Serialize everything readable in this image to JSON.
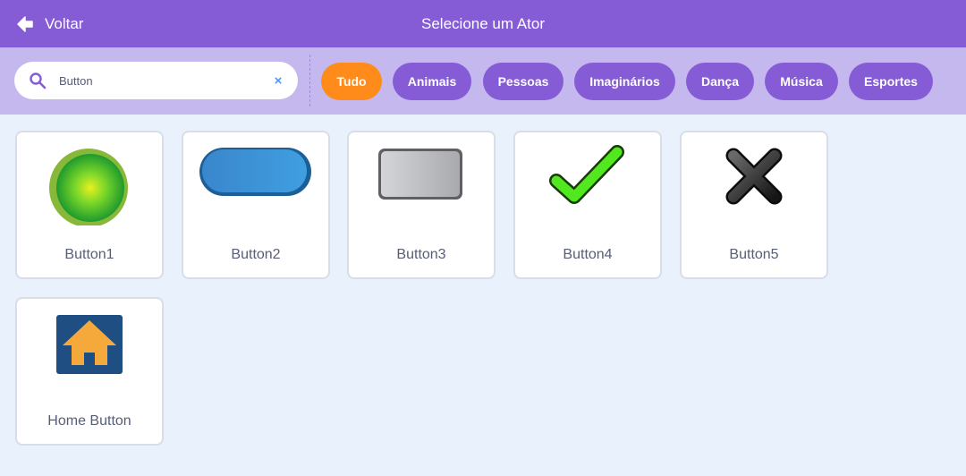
{
  "header": {
    "back_label": "Voltar",
    "title": "Selecione um Ator"
  },
  "search": {
    "value": "Button",
    "clear_glyph": "×"
  },
  "tags": [
    {
      "label": "Tudo",
      "active": true
    },
    {
      "label": "Animais",
      "active": false
    },
    {
      "label": "Pessoas",
      "active": false
    },
    {
      "label": "Imaginários",
      "active": false
    },
    {
      "label": "Dança",
      "active": false
    },
    {
      "label": "Música",
      "active": false
    },
    {
      "label": "Esportes",
      "active": false
    }
  ],
  "sprites": [
    {
      "name": "Button1",
      "icon": "green-circle-button-icon"
    },
    {
      "name": "Button2",
      "icon": "blue-pill-button-icon"
    },
    {
      "name": "Button3",
      "icon": "gray-rectangle-button-icon"
    },
    {
      "name": "Button4",
      "icon": "green-checkmark-icon"
    },
    {
      "name": "Button5",
      "icon": "black-x-icon"
    },
    {
      "name": "Home Button",
      "icon": "home-icon"
    }
  ],
  "colors": {
    "header": "#855cd6",
    "filter_bar": "#c5b8ee",
    "active_tag": "#ff8c1a",
    "tag": "#855cd6",
    "background": "#e9f1fc"
  }
}
